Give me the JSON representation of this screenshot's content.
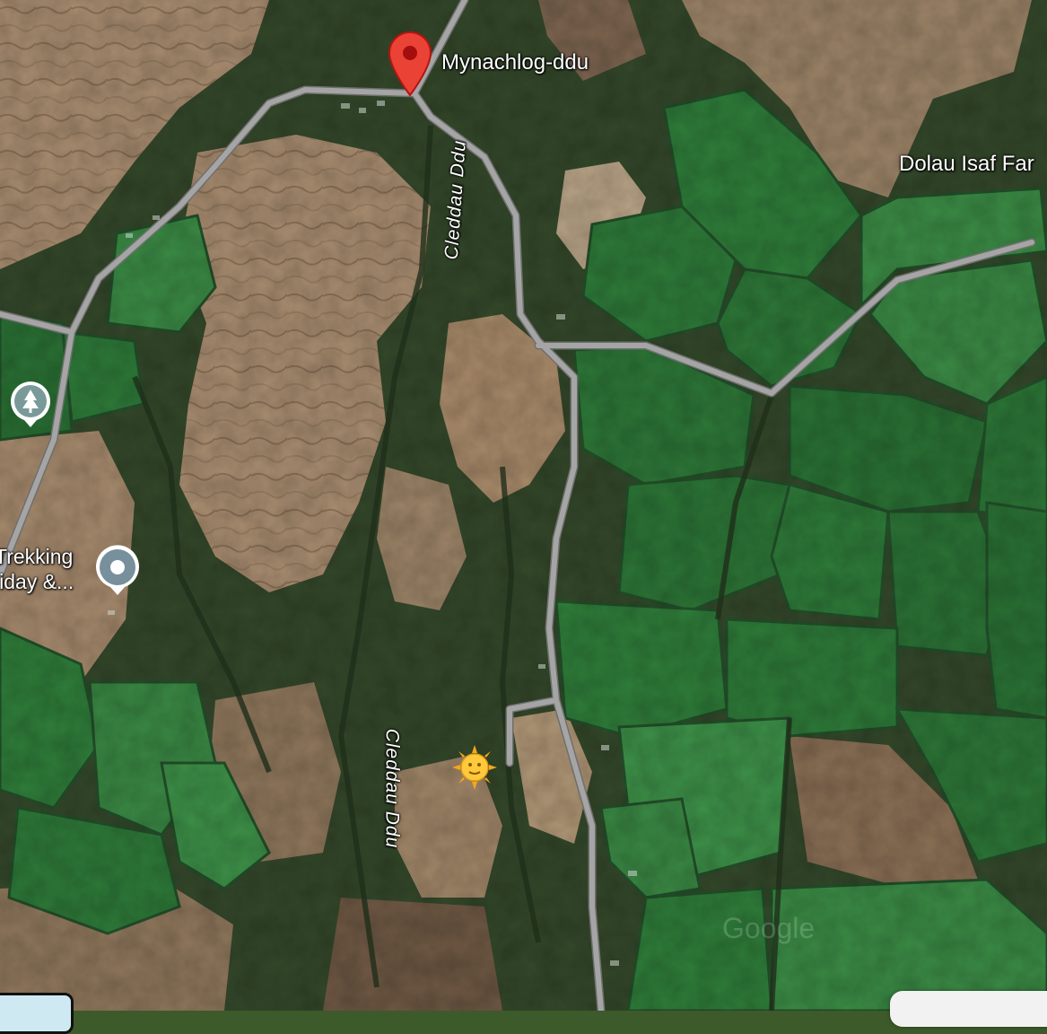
{
  "map": {
    "places": {
      "village": "Mynachlog-ddu",
      "farm": "Dolau Isaf Far"
    },
    "rivers": {
      "upper": "Cleddau Ddu",
      "lower": "Cleddau Ddu"
    },
    "poi": {
      "line1": "Trekking",
      "line2": "liday &..."
    },
    "watermark": "Google",
    "icons": {
      "pin": "location-pin-icon",
      "park": "tree-icon",
      "poi": "poi-dot-icon",
      "weather": "sun-icon"
    },
    "colors": {
      "road": "#9a9a9a",
      "pin": "#ea4335",
      "field": "#2f7d3a",
      "moor": "#a88a6a"
    }
  }
}
